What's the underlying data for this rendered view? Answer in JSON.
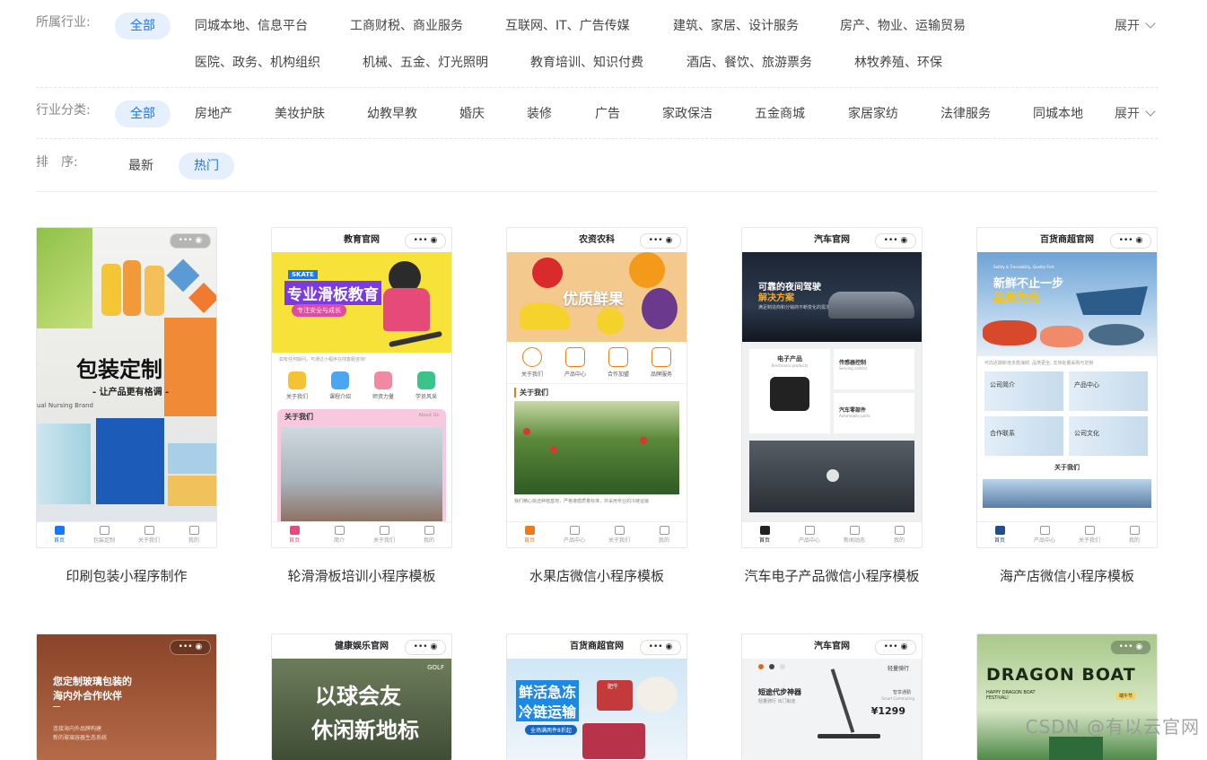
{
  "filters": {
    "industry": {
      "label": "所属行业:",
      "options_row1": [
        "全部",
        "同城本地、信息平台",
        "工商财税、商业服务",
        "互联网、IT、广告传媒",
        "建筑、家居、设计服务",
        "房产、物业、运输贸易"
      ],
      "options_row2": [
        "医院、政务、机构组织",
        "机械、五金、灯光照明",
        "教育培训、知识付费",
        "酒店、餐饮、旅游票务",
        "林牧养殖、环保"
      ],
      "expand": "展开"
    },
    "category": {
      "label": "行业分类:",
      "options": [
        "全部",
        "房地产",
        "美妆护肤",
        "幼教早教",
        "婚庆",
        "装修",
        "广告",
        "家政保洁",
        "五金商城",
        "家居家纺",
        "法律服务",
        "同城本地"
      ],
      "expand": "展开"
    },
    "sort": {
      "label": "排　序:",
      "options": [
        "最新",
        "热门"
      ]
    }
  },
  "templates_row1": [
    {
      "title": "印刷包装小程序制作",
      "header": "",
      "banner": "包装定制",
      "banner_sub": "- 让产品更有格调 -",
      "brand_text": "ual Nursing Brand",
      "tabs": [
        "首页",
        "包装定制",
        "关于我们",
        "我的"
      ]
    },
    {
      "title": "轮滑滑板培训小程序模板",
      "header": "教育官网",
      "banner": "专业滑板教育",
      "banner_sub": "专注安全与成长",
      "badge": "SKATE",
      "notice": "如有任何疑问，可通过小程序在线客服咨询!",
      "icons": [
        "关于我们",
        "课程介绍",
        "师资力量",
        "学员风采"
      ],
      "section": "关于我们",
      "section_en": "About Us",
      "tabs": [
        "首页",
        "简介",
        "关于我们",
        "我的"
      ]
    },
    {
      "title": "水果店微信小程序模板",
      "header": "农资农科",
      "banner": "优质鲜果",
      "icons": [
        "关于我们",
        "产品中心",
        "合作加盟",
        "品牌服务"
      ],
      "section": "关于我们",
      "body": "我们精心挑选种植基地，严格遵循质量标准，并采用专业的冷链运输",
      "tabs": [
        "首页",
        "产品中心",
        "关于我们",
        "我的"
      ]
    },
    {
      "title": "汽车电子产品微信小程序模板",
      "header": "汽车官网",
      "banner": "可靠的夜间驾驶",
      "banner2": "解决方案",
      "banner_sub": "满足制造商和分销商不断变化的需求",
      "cells": [
        "电子产品",
        "传感器控制",
        "汽车零部件"
      ],
      "cells_en": [
        "Electronics products",
        "Sensing control",
        "Automobile parts"
      ],
      "tabs": [
        "首页",
        "产品中心",
        "新闻动态",
        "我的"
      ]
    },
    {
      "title": "海产店微信小程序模板",
      "header": "百货商超官网",
      "banner": "新鲜不止一步",
      "banner2": "品质为先",
      "banner_en": "Safety & Traceability, Quality First",
      "notice": "可向近期新增多款海鲜, 品类更全, 支持批量采购与定制",
      "cells": [
        "公司简介",
        "产品中心",
        "合作联系",
        "公司文化"
      ],
      "section": "关于我们",
      "tabs": [
        "首页",
        "产品中心",
        "关于我们",
        "我的"
      ]
    }
  ],
  "templates_row2": [
    {
      "header": "",
      "banner": "您定制玻璃包装的",
      "banner2": "海内外合作伙伴",
      "banner_sub": "连接海内外品牌构建",
      "banner_sub2": "新的玻璃容器生态系统"
    },
    {
      "header": "健康娱乐官网",
      "banner": "以球会友",
      "banner2": "休闲新地标",
      "badge": "GOLF"
    },
    {
      "header": "百货商超官网",
      "banner": "鲜活急冻",
      "banner2": "冷链运输",
      "badge": "肥牛",
      "banner_sub": "全场满两件8折起"
    },
    {
      "header": "汽车官网",
      "banner": "短途代步神器",
      "banner_sub": "轻量骑行 出门就走",
      "badge": "轻量骑行",
      "sub_title": "智享通勤",
      "sub_en": "Smart Commuting",
      "price": "¥1299"
    },
    {
      "header": "",
      "banner": "DRAGON BOAT",
      "banner_sub": "HAPPY DRAGON BOAT FESTIVAL!",
      "badge": "端午节"
    }
  ],
  "capsule": "••• ◉",
  "watermark": "CSDN @有以云官网",
  "colors": {
    "accent": "#1677ff",
    "active_bg": "#e6f0fd"
  }
}
